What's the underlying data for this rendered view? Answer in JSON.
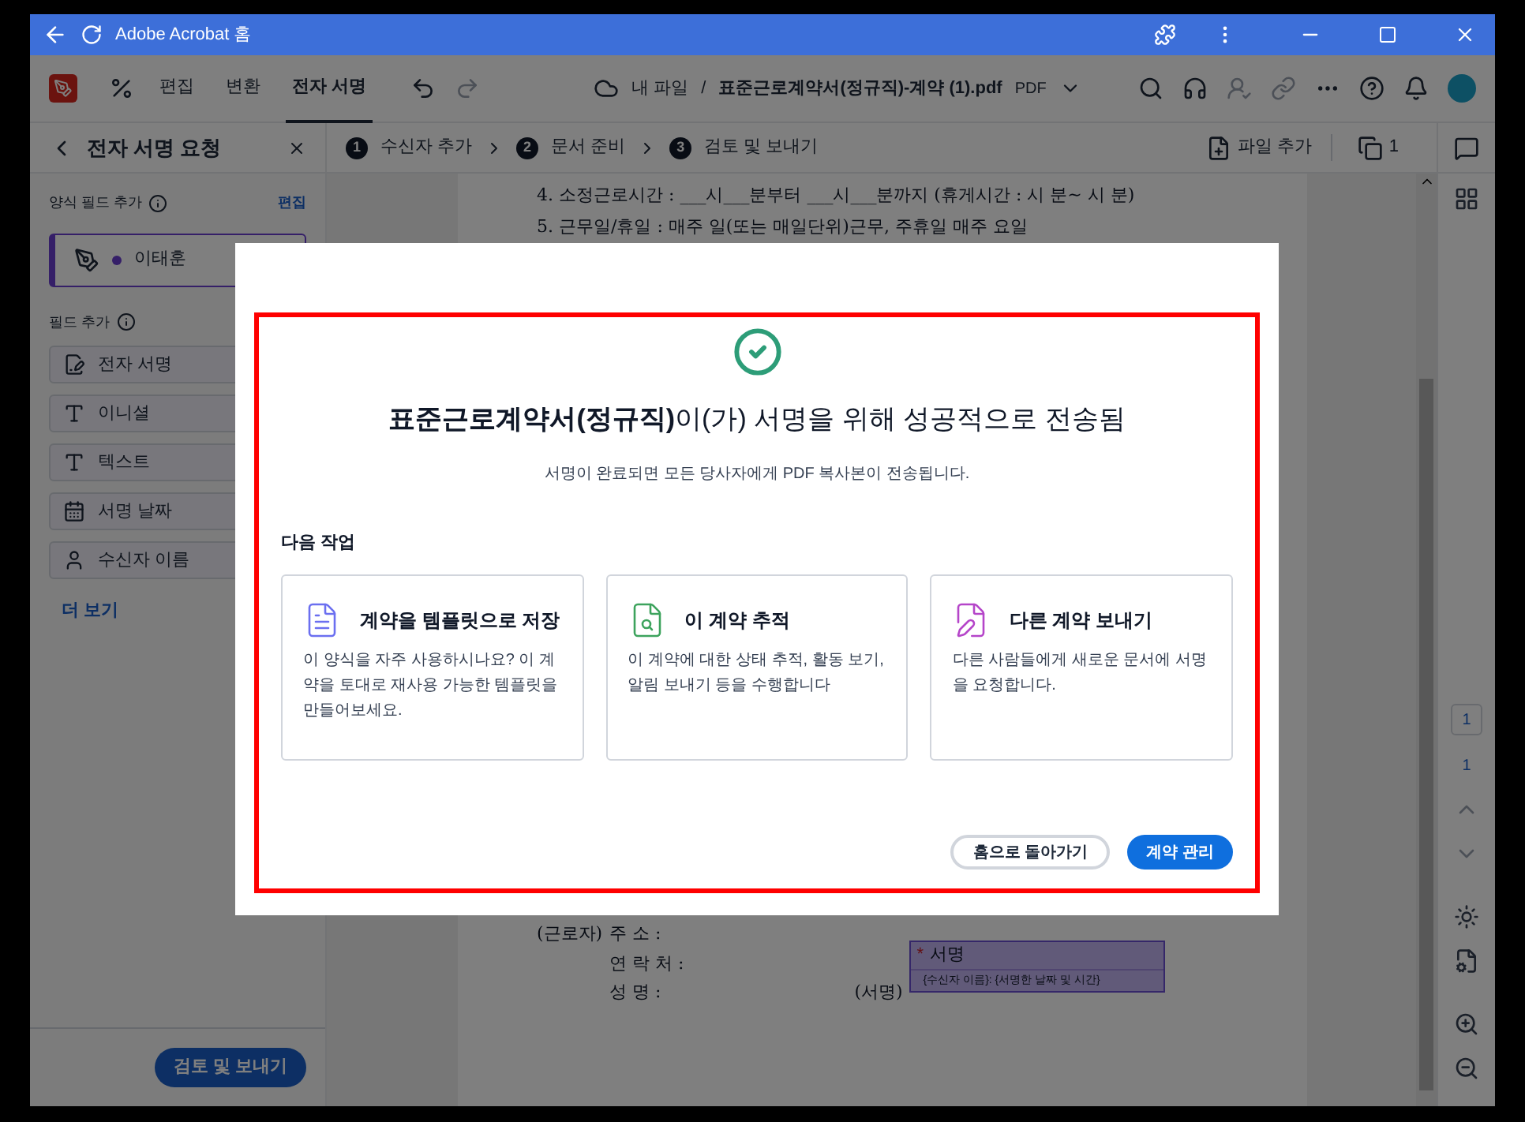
{
  "titlebar": {
    "title": "Adobe Acrobat 홈"
  },
  "toolbar": {
    "menu": [
      {
        "label": "편집",
        "selected": false
      },
      {
        "label": "변환",
        "selected": false
      },
      {
        "label": "전자 서명",
        "selected": true
      }
    ],
    "breadcrumb": "내 파일",
    "separator": "/",
    "filename": "표준근로계약서(정규직)-계약 (1).pdf",
    "filetype": "PDF"
  },
  "panel": {
    "title": "전자 서명 요청",
    "form_fields_label": "양식 필드 추가",
    "edit_link": "편집",
    "recipient": {
      "name": "이태훈",
      "selected": true,
      "color": "#351f68"
    },
    "add_fields_label": "필드 추가",
    "fields": [
      {
        "label": "전자 서명"
      },
      {
        "label": "이니셜"
      },
      {
        "label": "텍스트"
      },
      {
        "label": "서명 날짜"
      },
      {
        "label": "수신자 이름"
      }
    ],
    "more_link": "더 보기",
    "review_button": "검토 및 보내기"
  },
  "steps": [
    {
      "number": "1",
      "label": "수신자 추가"
    },
    {
      "number": "2",
      "label": "문서 준비"
    },
    {
      "number": "3",
      "label": "검토 및 보내기"
    }
  ],
  "step_actions": {
    "add_file": "파일 추가",
    "page_count": "1"
  },
  "document": {
    "lines": [
      "4. 소정근로시간 : ___시___분부터 ___시___분까지 (휴게시간 : 시 분~ 시 분)",
      "5. 근무일/휴일 : 매주 일(또는 매일단위)근무, 주휴일 매주 요일"
    ],
    "signer": {
      "role": "(근로자)",
      "rows": [
        "주 소 :",
        "연 락 처 :",
        "성 명 :"
      ],
      "sign_label": "(서명)",
      "field_required": "*",
      "field_title": "서명",
      "field_hint": "{수신자 이름}: {서명한 날짜 및 시간}"
    }
  },
  "right_rail": {
    "page_input": "1",
    "page_total": "1"
  },
  "dialog": {
    "title": "**표준근로계약서(정규직)**이(가) 서명을 위해 성공적으로 전송됨",
    "subtitle": "서명이 완료되면 모든 당사자에게 PDF 복사본이 전송됩니다.",
    "next_label": "다음 작업",
    "cards": [
      {
        "title": "계약을 템플릿으로 저장",
        "text": "이 양식을 자주 사용하시나요? 이 계약을 토대로 재사용 가능한 템플릿을 만들어보세요."
      },
      {
        "title": "이 계약 추적",
        "text": "이 계약에 대한 상태 추적, 활동 보기, 알림 보내기 등을 수행합니다"
      },
      {
        "title": "다른 계약 보내기",
        "text": "다른 사람들에게 새로운 문서에 서명을 요청합니다."
      }
    ],
    "secondary_button": "홈으로 돌아가기",
    "primary_button": "계약 관리"
  }
}
